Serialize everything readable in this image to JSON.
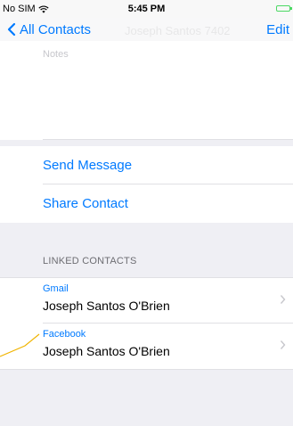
{
  "status_bar": {
    "carrier": "No SIM",
    "time": "5:45 PM"
  },
  "nav": {
    "back_label": "All Contacts",
    "edit_label": "Edit",
    "ghost_title": "Joseph Santos 7402"
  },
  "notes": {
    "label": "Notes"
  },
  "actions": [
    {
      "label": "Send Message"
    },
    {
      "label": "Share Contact"
    }
  ],
  "linked": {
    "header": "LINKED CONTACTS",
    "items": [
      {
        "service": "Gmail",
        "name": "Joseph Santos O'Brien"
      },
      {
        "service": "Facebook",
        "name": "Joseph Santos O'Brien"
      }
    ]
  },
  "colors": {
    "accent": "#007aff",
    "background": "#efeff4",
    "callout": "#f0b400",
    "battery": "#4cd964"
  }
}
